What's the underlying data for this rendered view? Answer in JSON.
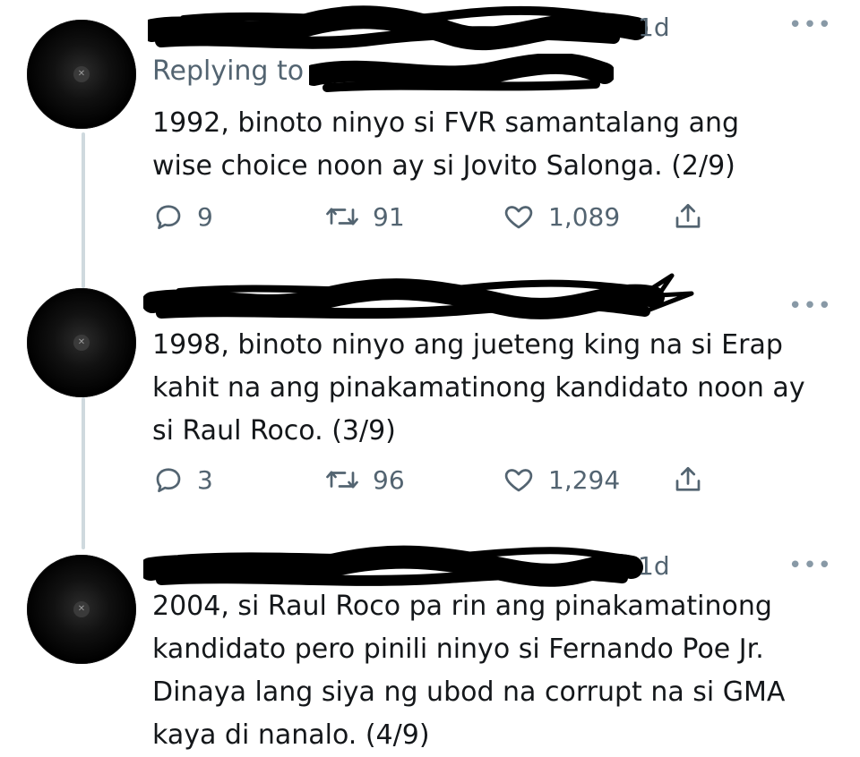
{
  "tweets": [
    {
      "time": "1d",
      "reply_prefix": "Replying to",
      "text": "1992, binoto ninyo si FVR samantalang ang\nwise choice noon ay si Jovito Salonga. (2/9)",
      "replies": "9",
      "retweets": "91",
      "likes": "1,089"
    },
    {
      "text": "1998, binoto ninyo ang jueteng king na si Erap\nkahit na ang pinakamatinong kandidato noon ay\nsi Raul Roco. (3/9)",
      "replies": "3",
      "retweets": "96",
      "likes": "1,294"
    },
    {
      "time": "1d",
      "text": "2004, si Raul Roco pa rin ang pinakamatinong\nkandidato pero pinili ninyo si Fernando Poe Jr.\nDinaya lang siya ng ubod na corrupt na si GMA\nkaya di nanalo. (4/9)"
    }
  ],
  "icons": {
    "reply": "reply-icon",
    "retweet": "retweet-icon",
    "like": "heart-icon",
    "share": "share-icon",
    "more": "more-options-icon"
  },
  "colors": {
    "text": "#14171a",
    "muted": "#536471",
    "thread_line": "#cfd9de",
    "redaction": "#000000"
  }
}
